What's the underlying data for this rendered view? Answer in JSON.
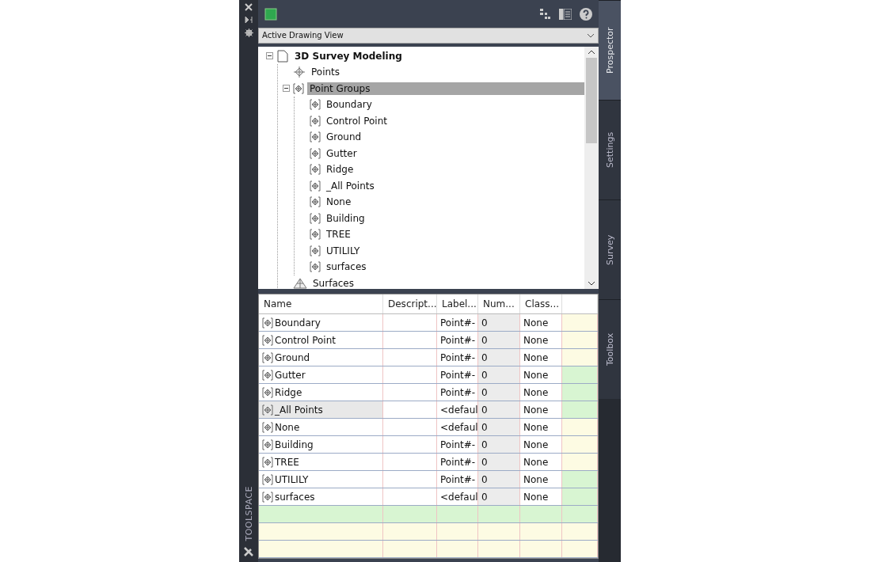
{
  "palette_title": "TOOLSPACE",
  "view_dropdown": {
    "value": "Active Drawing View"
  },
  "tree": [
    {
      "label": "3D Survey Modeling",
      "kind": "document",
      "expanded": true,
      "selected": false,
      "children": [
        {
          "label": "Points",
          "kind": "points",
          "selected": false
        },
        {
          "label": "Point Groups",
          "kind": "group",
          "expanded": true,
          "selected": true,
          "children": [
            {
              "label": "Boundary",
              "kind": "group",
              "selected": false
            },
            {
              "label": "Control Point",
              "kind": "group",
              "selected": false
            },
            {
              "label": "Ground",
              "kind": "group",
              "selected": false
            },
            {
              "label": "Gutter",
              "kind": "group",
              "selected": false
            },
            {
              "label": "Ridge",
              "kind": "group",
              "selected": false
            },
            {
              "label": "_All Points",
              "kind": "group",
              "selected": false
            },
            {
              "label": "None",
              "kind": "group",
              "selected": false
            },
            {
              "label": "Building",
              "kind": "group",
              "selected": false
            },
            {
              "label": "TREE",
              "kind": "group",
              "selected": false
            },
            {
              "label": "UTILILY",
              "kind": "group",
              "selected": false
            },
            {
              "label": "surfaces",
              "kind": "group",
              "selected": false
            }
          ]
        },
        {
          "label": "Surfaces",
          "kind": "surface",
          "selected": false
        }
      ]
    }
  ],
  "table": {
    "columns": [
      "Name",
      "Descript...",
      "Label...",
      "Num...",
      "Class..."
    ],
    "rows": [
      {
        "name": "Boundary",
        "label_style": "Point#-",
        "number": "0",
        "classification": "None",
        "color": "#fdfbe3",
        "selected": false
      },
      {
        "name": "Control Point",
        "label_style": "Point#-",
        "number": "0",
        "classification": "None",
        "color": "#fdfbe3",
        "selected": false
      },
      {
        "name": "Ground",
        "label_style": "Point#-",
        "number": "0",
        "classification": "None",
        "color": "#fdfbe3",
        "selected": false
      },
      {
        "name": "Gutter",
        "label_style": "Point#-",
        "number": "0",
        "classification": "None",
        "color": "#d8f5d2",
        "selected": false
      },
      {
        "name": "Ridge",
        "label_style": "Point#-",
        "number": "0",
        "classification": "None",
        "color": "#d8f5d2",
        "selected": false
      },
      {
        "name": "_All Points",
        "label_style": "<defaul",
        "number": "0",
        "classification": "None",
        "color": "#d8f5d2",
        "selected": true
      },
      {
        "name": "None",
        "label_style": "<defaul",
        "number": "0",
        "classification": "None",
        "color": "#fdfbe3",
        "selected": false
      },
      {
        "name": "Building",
        "label_style": "Point#-",
        "number": "0",
        "classification": "None",
        "color": "#fdfbe3",
        "selected": false
      },
      {
        "name": "TREE",
        "label_style": "Point#-",
        "number": "0",
        "classification": "None",
        "color": "#fdfbe3",
        "selected": false
      },
      {
        "name": "UTILILY",
        "label_style": "Point#-",
        "number": "0",
        "classification": "None",
        "color": "#d8f5d2",
        "selected": false
      },
      {
        "name": "surfaces",
        "label_style": "<defaul",
        "number": "0",
        "classification": "None",
        "color": "#d8f5d2",
        "selected": false
      }
    ],
    "empty_rows": [
      {
        "color": "#d8f5d2"
      },
      {
        "color": "#fdfbe3"
      },
      {
        "color": "#fdfbe3"
      }
    ]
  },
  "side_tabs": [
    {
      "label": "Prospector",
      "selected": true
    },
    {
      "label": "Settings",
      "selected": false
    },
    {
      "label": "Survey",
      "selected": false
    },
    {
      "label": "Toolbox",
      "selected": false
    }
  ]
}
